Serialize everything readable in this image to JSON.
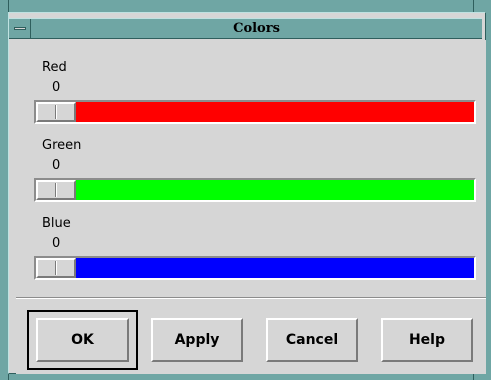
{
  "window": {
    "title": "Colors"
  },
  "sliders": [
    {
      "label": "Red",
      "value": "0",
      "color": "#ff0000",
      "level": 0
    },
    {
      "label": "Green",
      "value": "0",
      "color": "#00ff00",
      "level": 0
    },
    {
      "label": "Blue",
      "value": "0",
      "color": "#0000ff",
      "level": 0
    }
  ],
  "buttons": {
    "ok": "OK",
    "apply": "Apply",
    "cancel": "Cancel",
    "help": "Help"
  },
  "icons": {
    "window_menu": "window-menu-icon"
  },
  "theme": {
    "frame": "#6fa6a4",
    "background": "#d6d6d6"
  }
}
